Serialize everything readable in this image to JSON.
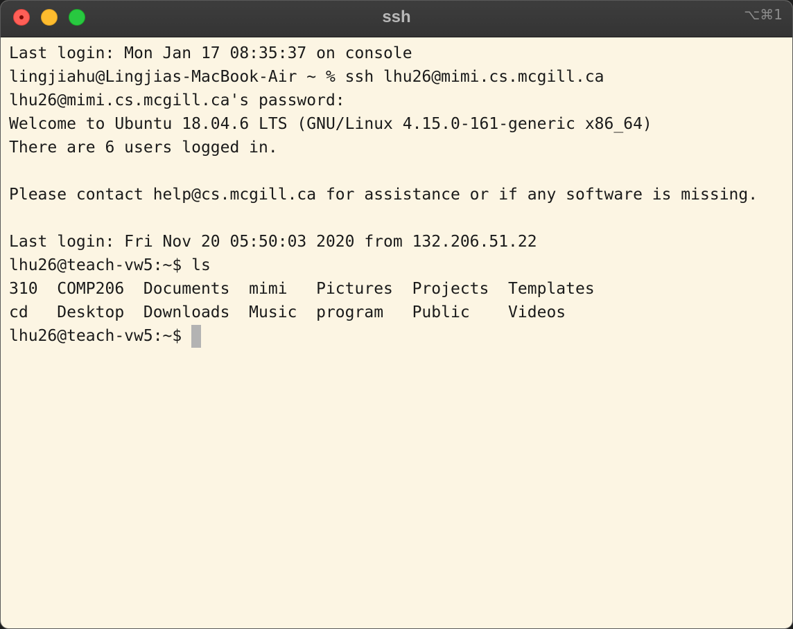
{
  "window": {
    "title": "ssh",
    "shortcut": "⌥⌘1",
    "colors": {
      "background": "#fcf5e3",
      "titlebar": "#383838",
      "close": "#ff5f57",
      "minimize": "#febc2e",
      "zoom": "#28c840",
      "cursor": "#b3b3b3"
    }
  },
  "terminal": {
    "lines": [
      "Last login: Mon Jan 17 08:35:37 on console",
      "lingjiahu@Lingjias-MacBook-Air ~ % ssh lhu26@mimi.cs.mcgill.ca",
      "lhu26@mimi.cs.mcgill.ca's password:",
      "Welcome to Ubuntu 18.04.6 LTS (GNU/Linux 4.15.0-161-generic x86_64)",
      "There are 6 users logged in.",
      "",
      "Please contact help@cs.mcgill.ca for assistance or if any software is missing.",
      "",
      "Last login: Fri Nov 20 05:50:03 2020 from 132.206.51.22",
      "lhu26@teach-vw5:~$ ls",
      "310  COMP206  Documents  mimi   Pictures  Projects  Templates",
      "cd   Desktop  Downloads  Music  program   Public    Videos"
    ],
    "prompt": "lhu26@teach-vw5:~$"
  }
}
